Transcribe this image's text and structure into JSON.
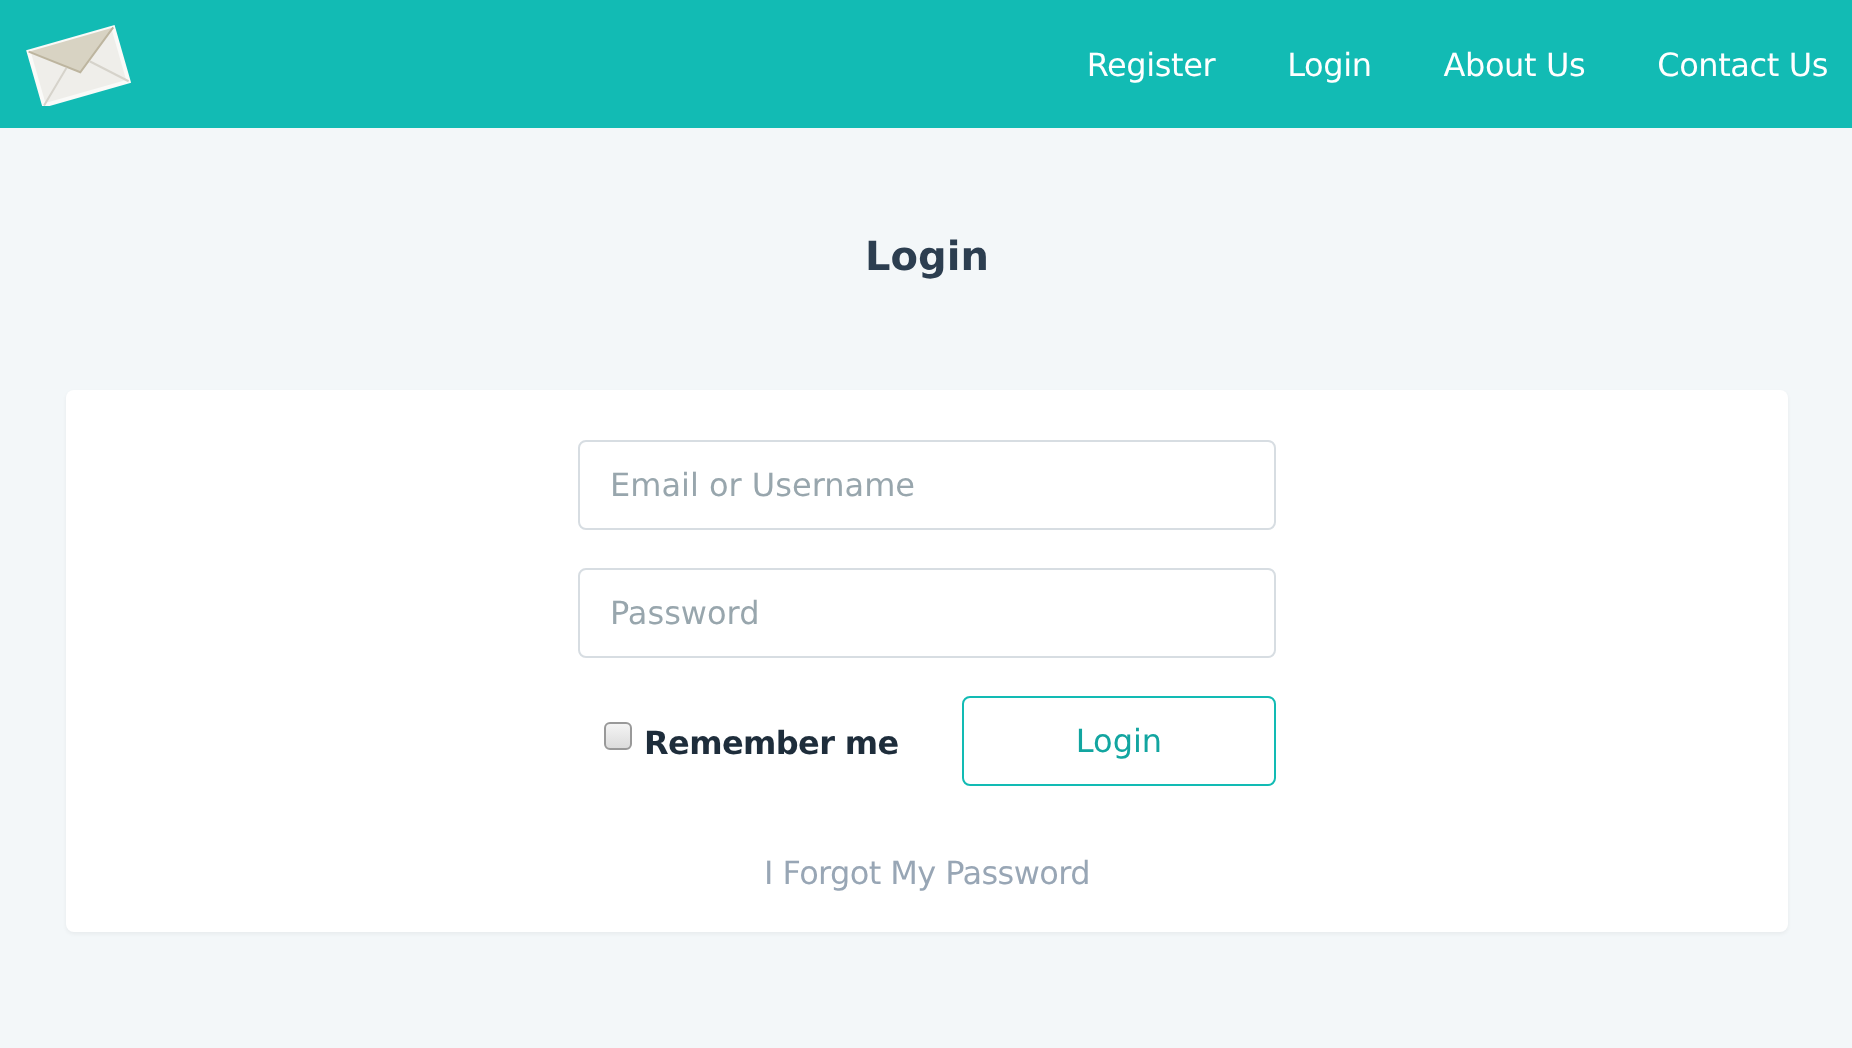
{
  "nav": {
    "items": [
      {
        "label": "Register"
      },
      {
        "label": "Login"
      },
      {
        "label": "About Us"
      },
      {
        "label": "Contact Us"
      }
    ]
  },
  "heading": "Login",
  "form": {
    "username": {
      "placeholder": "Email or Username"
    },
    "password": {
      "placeholder": "Password"
    },
    "remember": {
      "label": "Remember me",
      "checked": false
    },
    "submit": "Login",
    "forgot": "I Forgot My Password"
  }
}
